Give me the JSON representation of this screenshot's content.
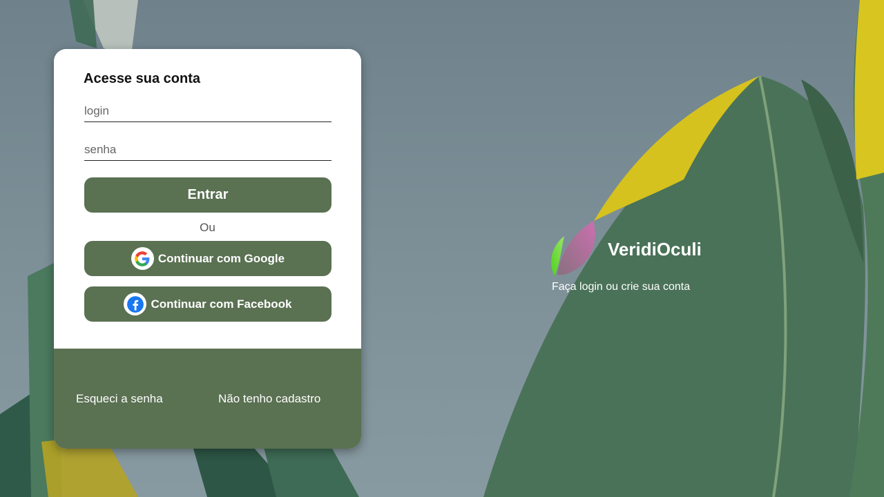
{
  "login_card": {
    "title": "Acesse sua conta",
    "login_placeholder": "login",
    "password_placeholder": "senha",
    "submit_label": "Entrar",
    "separator": "Ou",
    "google_label": "Continuar com Google",
    "facebook_label": "Continuar com Facebook",
    "forgot_password": "Esqueci a senha",
    "register": "Não tenho cadastro"
  },
  "brand": {
    "name": "VeridiOculi",
    "subtitle": "Faça login ou crie sua conta"
  },
  "colors": {
    "accent": "#5a7152",
    "card": "#ffffff"
  },
  "icons": {
    "google": "google-icon",
    "facebook": "facebook-icon",
    "logo": "leaf-logo-icon"
  }
}
